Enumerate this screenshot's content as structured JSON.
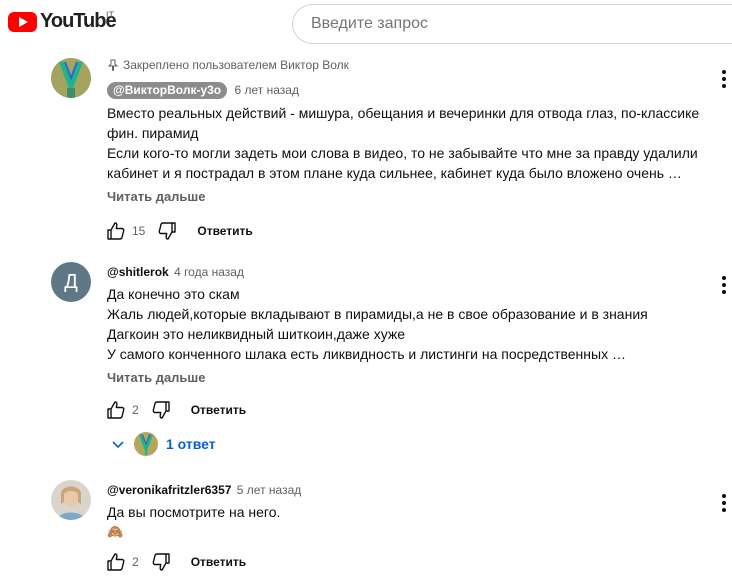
{
  "header": {
    "logo_text": "YouTube",
    "region": "IT",
    "search_placeholder": "Введите запрос"
  },
  "comments": [
    {
      "pinned_label": "Закреплено пользователем Виктор Волк",
      "author": "@ВикторВолк-у3о",
      "time": "6 лет назад",
      "lines": [
        "Вместо реальных действий - мишура, обещания и вечеринки для отвода глаз, по-классике",
        "фин. пирамид",
        "Если кого-то могли задеть мои слова в видео, то не забывайте что мне за правду удалили",
        "кабинет и я пострадал в этом плане куда сильнее, кабинет куда было вложено очень …"
      ],
      "read_more": "Читать дальше",
      "likes": "15",
      "reply_label": "Ответить"
    },
    {
      "author": "@shitlerok",
      "time": "4 года назад",
      "avatar_letter": "Д",
      "lines": [
        "Да конечно это скам",
        "Жаль людей,которые вкладывают в пирамиды,а не в свое образование и в знания",
        "Дагкоин это неликвидный шиткоин,даже хуже",
        "У самого конченного шлака есть ликвидность и листинги на посредственных …"
      ],
      "read_more": "Читать дальше",
      "likes": "2",
      "reply_label": "Ответить",
      "replies_label": "1 ответ"
    },
    {
      "author": "@veronikafritzler6357",
      "time": "5 лет назад",
      "lines": [
        "Да вы посмотрите на него.",
        "🙈"
      ],
      "likes": "2",
      "reply_label": "Ответить"
    }
  ],
  "colors": {
    "brand_red": "#ff0000",
    "link_blue": "#065fd4",
    "avatar_grey": "#5f7886"
  }
}
